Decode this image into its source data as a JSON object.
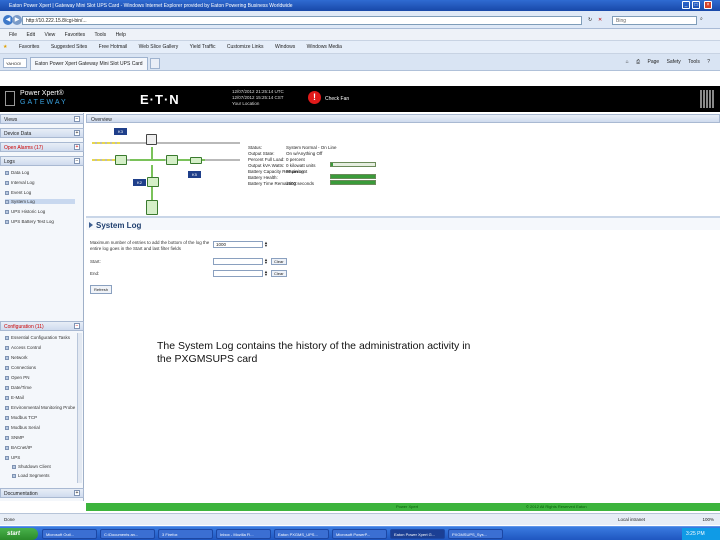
{
  "window": {
    "title": "Eaton Power Xpert | Gateway Mini Slot UPS Card - Windows Internet Explorer provided by Eaton Powering Business Worldwide"
  },
  "address": {
    "url": "http://10.222.15.8/cgi-bin/...",
    "search": "Bing"
  },
  "menu": [
    "File",
    "Edit",
    "View",
    "Favorites",
    "Tools",
    "Help"
  ],
  "favorites": [
    "Favorites",
    "Suggested Sites",
    "Free Hotmail",
    "Web Slice Gallery",
    "Yield Traffic",
    "Customize Links",
    "Windows",
    "Windows Media"
  ],
  "tabs": {
    "pill": "YAHOO!",
    "active": "Eaton Power Xpert Gateway Mini Slot UPS Card"
  },
  "commands": [
    "Page",
    "Safety",
    "Tools"
  ],
  "banner": {
    "logo_line1": "Power Xpert®",
    "logo_line2": "GATEWAY",
    "brand": "E·T·N",
    "time1": "12/07/2012 21:25:14 UTC",
    "time2": "12/07/2012 15:25:14 CST",
    "user": "Your Location",
    "alert": "Check Fan"
  },
  "sidebar": {
    "sections": [
      {
        "label": "Views"
      },
      {
        "label": "Device Data"
      },
      {
        "label": "Open Alarms (17)"
      },
      {
        "label": "Logs"
      }
    ],
    "logs": [
      "Data Log",
      "Interval Log",
      "Event Log",
      "System Log",
      "UPS Historic Log",
      "UPS Battery Test Log"
    ],
    "config_label": "Configuration (11)",
    "config_items": [
      "Essential Configuration Tasks",
      "Access Control",
      "Network",
      "Connections",
      "Open PN",
      "Date/Time",
      "E-Mail",
      "Environmental Monitoring Probe",
      "Modbus TCP",
      "Modbus Serial",
      "SNMP",
      "BACnet/IP",
      "UPS",
      "Shutdown Client",
      "Load Segments"
    ],
    "doc_label": "Documentation"
  },
  "main": {
    "overview_label": "Overview",
    "diagram_labels": {
      "k1": "K3",
      "k2": "K2",
      "k3": "K5"
    },
    "status": [
      {
        "k": "Status:",
        "v": "System Normal - On Line"
      },
      {
        "k": "Output State:",
        "v": "On w/Anything Off"
      },
      {
        "k": "Percent Full Load:",
        "v": "0 percent"
      },
      {
        "k": "Output kVA Watts:",
        "v": "0 kilowatt units"
      },
      {
        "k": "Battery Capacity Remaining:",
        "v": "99 percent"
      },
      {
        "k": "Battery Health:",
        "v": ""
      },
      {
        "k": "Battery Time Remaining:",
        "v": "1500 seconds"
      }
    ],
    "bars": [
      {
        "level": 0.04
      },
      {
        "level": 0.99
      },
      {
        "level": 1.0
      }
    ],
    "syslog_title": "System Log",
    "form_desc": "Maximum number of entries to add the bottom of the log the entire log goes in the Start and last filter fields",
    "max_value": "1000",
    "start_label": "Start:",
    "end_label": "End:",
    "clear_label": "Clear",
    "refresh_label": "Refresh",
    "caption": "The System Log contains the history of the  administration activity in the PXGMSUPS card"
  },
  "green_strip": {
    "a": "Power Xpert",
    "b": "© 2012 All Rights Reserved Eaton"
  },
  "status_bar": {
    "left": "Done",
    "zone": "Local intranet",
    "zoom": "100%"
  },
  "taskbar": {
    "start": "start",
    "tasks": [
      "Microsoft Outl...",
      "C:\\Documents an...",
      "3 Firefox",
      "Inbox - Mozilla Fi...",
      "Eaton PXGMS_UPS...",
      "Microsoft PowerP...",
      "Eaton Power Xpert G...",
      "PXGMSUPS_Sys..."
    ],
    "clock": "3:25 PM"
  }
}
